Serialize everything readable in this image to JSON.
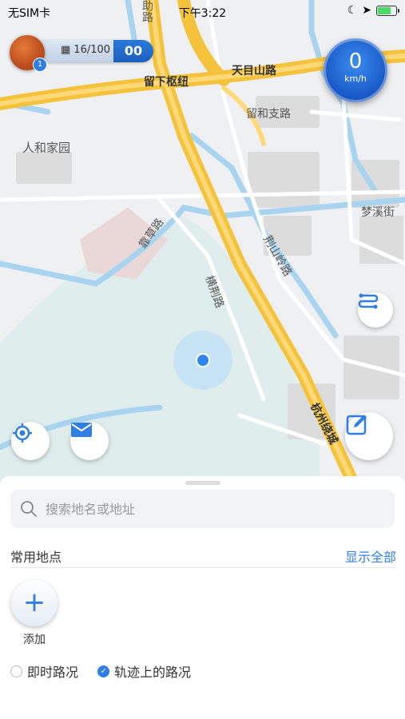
{
  "status": {
    "carrier": "无SIM卡",
    "time": "下午3:22",
    "battery_level": 0.8
  },
  "player": {
    "level_badge": "1",
    "capacity": "16/100",
    "score": "00"
  },
  "speed": {
    "value": "0",
    "unit": "km/h"
  },
  "map_labels": {
    "road_liuxia": "留下枢纽",
    "road_tianmu": "天目山路",
    "road_liuhezhi": "留和支路",
    "area_renhe": "人和家园",
    "road_mengxi": "梦溪街",
    "road_jingshanling": "荆山岭路",
    "road_hengjing": "横荆路",
    "road_huancheng": "杭州绕城",
    "road_zhu": "助路",
    "road_kaocao": "靠草路"
  },
  "sheet": {
    "search_placeholder": "搜索地名或地址",
    "common_places_title": "常用地点",
    "show_all": "显示全部",
    "add_label": "添加",
    "option_realtime": "即时路况",
    "option_track": "轨迹上的路况",
    "option_realtime_checked": false,
    "option_track_checked": true
  },
  "colors": {
    "accent": "#2f7ee3",
    "highway": "#f5c33b",
    "water": "#a9d4f0"
  }
}
